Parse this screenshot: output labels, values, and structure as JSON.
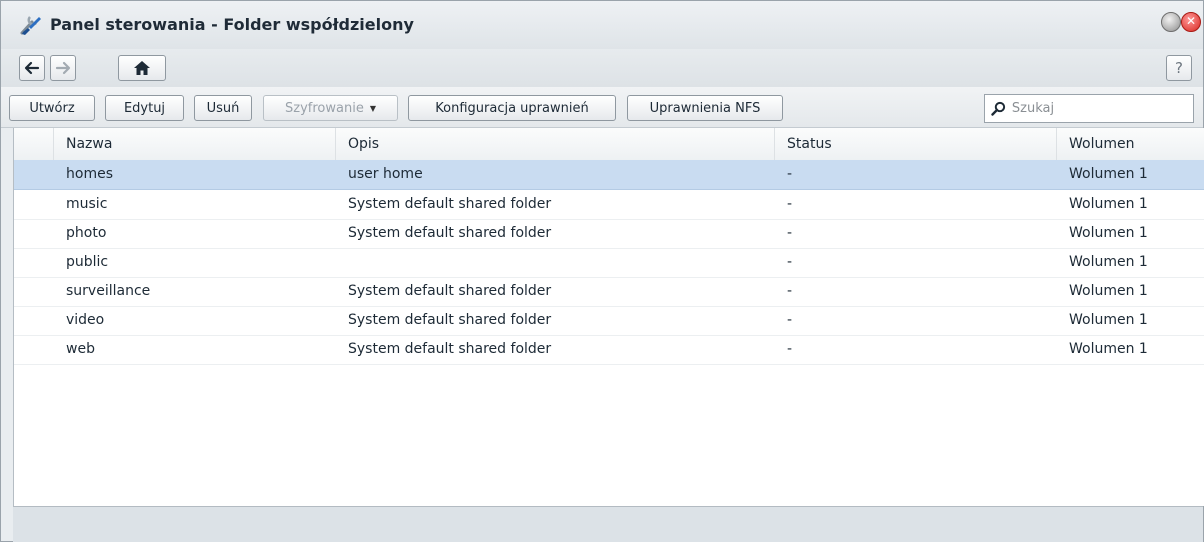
{
  "window": {
    "title": "Panel sterowania - Folder współdzielony",
    "app_icon": "control-panel-icon",
    "close_symbol": "✕"
  },
  "nav": {
    "back_icon": "arrow-left-icon",
    "forward_icon": "arrow-right-icon",
    "home_icon": "home-icon",
    "help_label": "?"
  },
  "toolbar": {
    "create_label": "Utwórz",
    "edit_label": "Edytuj",
    "delete_label": "Usuń",
    "encryption_label": "Szyfrowanie",
    "permissions_label": "Konfiguracja uprawnień",
    "nfs_label": "Uprawnienia NFS",
    "search_placeholder": "Szukaj"
  },
  "table": {
    "columns": [
      "",
      "Nazwa",
      "Opis",
      "Status",
      "Wolumen"
    ],
    "rows": [
      {
        "name": "homes",
        "description": "user home",
        "status": "-",
        "volume": "Wolumen 1"
      },
      {
        "name": "music",
        "description": "System default shared folder",
        "status": "-",
        "volume": "Wolumen 1"
      },
      {
        "name": "photo",
        "description": "System default shared folder",
        "status": "-",
        "volume": "Wolumen 1"
      },
      {
        "name": "public",
        "description": "",
        "status": "-",
        "volume": "Wolumen 1"
      },
      {
        "name": "surveillance",
        "description": "System default shared folder",
        "status": "-",
        "volume": "Wolumen 1"
      },
      {
        "name": "video",
        "description": "System default shared folder",
        "status": "-",
        "volume": "Wolumen 1"
      },
      {
        "name": "web",
        "description": "System default shared folder",
        "status": "-",
        "volume": "Wolumen 1"
      }
    ],
    "selected_row": 0
  },
  "colors": {
    "selected_row": "#c9dcf1",
    "close_button": "#d8261f"
  }
}
